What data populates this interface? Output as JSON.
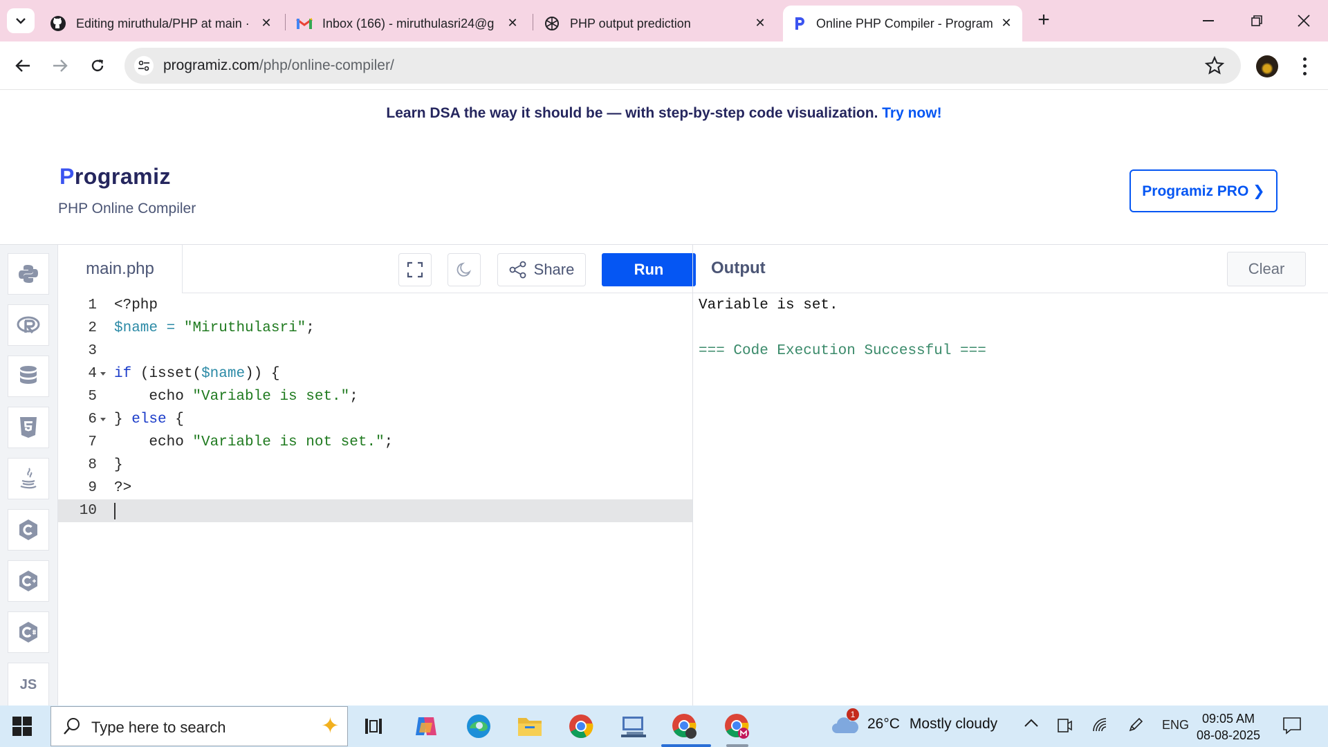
{
  "browser": {
    "tabs": [
      {
        "title": "Editing miruthula/PHP at main ·",
        "icon": "github-icon"
      },
      {
        "title": "Inbox (166) - miruthulasri24@g",
        "icon": "gmail-icon"
      },
      {
        "title": "PHP output prediction",
        "icon": "chatgpt-icon"
      },
      {
        "title": "Online PHP Compiler - Program",
        "icon": "programiz-icon",
        "active": true
      }
    ],
    "url_host": "programiz.com",
    "url_path": "/php/online-compiler/"
  },
  "page": {
    "banner_text": "Learn DSA the way it should be — with step-by-step code visualization.",
    "banner_link": "Try now!",
    "logo_first": "P",
    "logo_rest": "rogramiz",
    "subtitle": "PHP Online Compiler",
    "pro_button": "Programiz PRO ❯"
  },
  "sidebar": {
    "languages": [
      "python-icon",
      "r-icon",
      "sql-icon",
      "html5-icon",
      "java-icon",
      "c-icon",
      "cpp-icon",
      "csharp-icon",
      "JS"
    ]
  },
  "editor": {
    "filename": "main.php",
    "share_label": "Share",
    "run_label": "Run",
    "line_numbers": [
      "1",
      "2",
      "3",
      "4",
      "5",
      "6",
      "7",
      "8",
      "9",
      "10"
    ]
  },
  "output": {
    "title": "Output",
    "clear_label": "Clear",
    "lines": [
      "Variable is set.",
      "",
      "=== Code Execution Successful ==="
    ]
  },
  "taskbar": {
    "search_placeholder": "Type here to search",
    "weather_badge": "1",
    "temperature": "26°C",
    "weather_text": "Mostly cloudy",
    "language": "ENG",
    "time": "09:05 AM",
    "date": "08-08-2025"
  }
}
